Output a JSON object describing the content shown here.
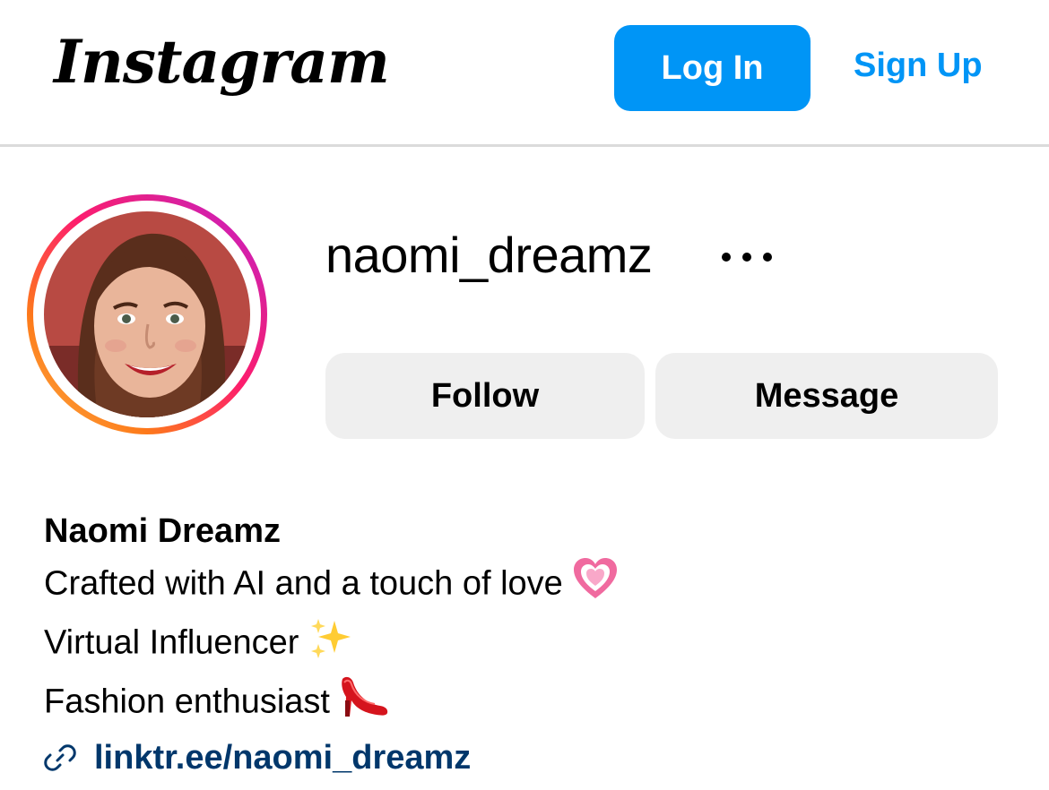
{
  "header": {
    "logo_text": "Instagram",
    "login_label": "Log In",
    "signup_label": "Sign Up",
    "accent_color": "#0095f6"
  },
  "profile": {
    "username": "naomi_dreamz",
    "more_icon": "more-horizontal-icon",
    "follow_label": "Follow",
    "message_label": "Message",
    "avatar_ring_colors": [
      "#fcb045",
      "#fd1d6d",
      "#c11ed7"
    ]
  },
  "bio": {
    "display_name": "Naomi Dreamz",
    "lines": [
      {
        "text": "Crafted with AI and a touch of love",
        "emoji": "growing-heart"
      },
      {
        "text": "Virtual Influencer",
        "emoji": "sparkles"
      },
      {
        "text": "Fashion enthusiast",
        "emoji": "high-heel-shoe"
      }
    ],
    "link_text": "linktr.ee/naomi_dreamz",
    "link_color": "#00376b",
    "link_icon": "link-icon"
  }
}
